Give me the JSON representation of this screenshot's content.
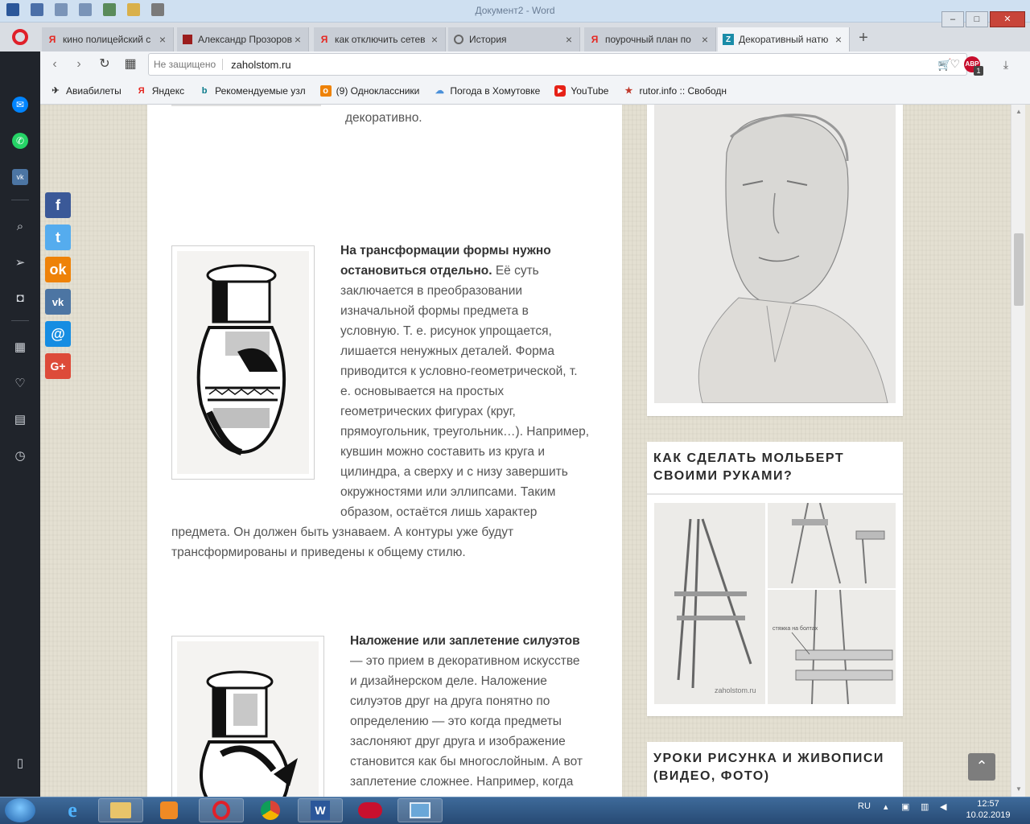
{
  "word_window": {
    "title": "Документ2 - Word"
  },
  "tabs": [
    {
      "label": "кино полицейский с",
      "favicon": "yandex-icon",
      "active": false
    },
    {
      "label": "Александр Прозоров",
      "favicon": "site-icon",
      "active": false
    },
    {
      "label": "как отключить сетев",
      "favicon": "yandex-icon",
      "active": false
    },
    {
      "label": "История",
      "favicon": "history-icon",
      "active": false
    },
    {
      "label": "поурочный план по",
      "favicon": "yandex-icon",
      "active": false
    },
    {
      "label": "Декоративный натю",
      "favicon": "zaholstom-icon",
      "active": true
    }
  ],
  "address": {
    "security": "Не защищено",
    "url": "zaholstom.ru"
  },
  "adblock": {
    "badge": "ABP",
    "count": "1"
  },
  "bookmarks": [
    {
      "label": "Авиабилеты",
      "icon": "plane-icon"
    },
    {
      "label": "Яндекс",
      "icon": "yandex-icon"
    },
    {
      "label": "Рекомендуемые узл",
      "icon": "bing-icon"
    },
    {
      "label": "(9) Одноклассники",
      "icon": "ok-icon"
    },
    {
      "label": "Погода в Хомутовке",
      "icon": "weather-icon"
    },
    {
      "label": "YouTube",
      "icon": "youtube-icon"
    },
    {
      "label": "rutor.info :: Свободн",
      "icon": "rutor-icon"
    }
  ],
  "article": {
    "top_fragment": "декоративно.",
    "para1_bold": "На трансформации формы нужно остановиться отдельно.",
    "para1_lines": [
      " Её суть",
      "заключается в преобразовании",
      "изначальной формы предмета в",
      "условную. Т. е. рисунок упрощается,",
      "лишается ненужных деталей. Форма",
      "приводится к условно-геометрической, т.",
      "е. основывается на простых",
      "геометрических фигурах (круг,",
      "прямоугольник, треугольник…). Например,",
      "кувшин можно составить из круга и",
      "цилиндра, а сверху и с низу завершить",
      "окружностями или эллипсами. Таким",
      "образом, остаётся лишь характер"
    ],
    "para1_tail": [
      "предмета. Он должен быть узнаваем. А контуры уже будут",
      "трансформированы и приведены к общему стилю."
    ],
    "para2_bold": "Наложение или заплетение силуэтов",
    "para2_lines": [
      "— это прием в декоративном искусстве",
      "и дизайнерском деле. Наложение",
      "силуэтов друг на друга понятно по",
      "определению — это когда предметы",
      "заслоняют друг друга и изображение",
      "становится как бы многослойным. А вот",
      "заплетение сложнее. Например, когда"
    ]
  },
  "sidebar_widgets": [
    {
      "title": ""
    },
    {
      "title": "КАК СДЕЛАТЬ МОЛЬБЕРТ СВОИМИ РУКАМИ?",
      "watermark": "zaholstom.ru",
      "label": "стяжка на болтах"
    },
    {
      "title": "УРОКИ РИСУНКА И ЖИВОПИСИ (ВИДЕО, ФОТО)"
    }
  ],
  "share_buttons": [
    "facebook-icon",
    "twitter-icon",
    "odnoklassniki-icon",
    "vk-icon",
    "mail-icon",
    "google-plus-icon"
  ],
  "taskbar": {
    "language": "RU",
    "time": "12:57",
    "date": "10.02.2019"
  },
  "colors": {
    "facebook": "#3b5998",
    "twitter": "#55acee",
    "ok": "#ee8208",
    "vk": "#4c75a3",
    "mail": "#168de2",
    "gplus": "#dd4b39"
  }
}
